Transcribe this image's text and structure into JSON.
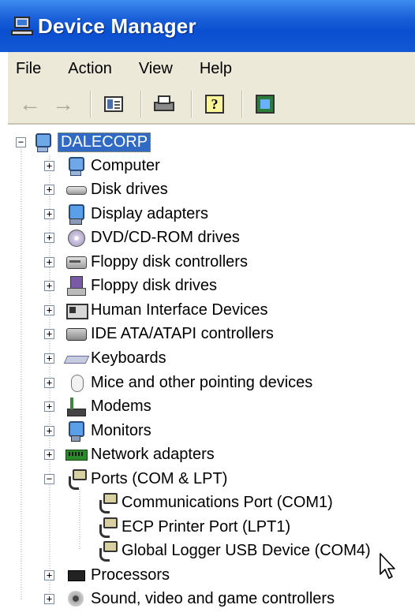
{
  "window": {
    "title": "Device Manager"
  },
  "menu": [
    "File",
    "Action",
    "View",
    "Help"
  ],
  "toolbar": {
    "buttons": [
      "back-icon",
      "forward-icon",
      "console-tree-icon",
      "print-icon",
      "help-icon",
      "scan-hardware-icon"
    ]
  },
  "tree": {
    "root": "DALECORP",
    "categories": [
      {
        "label": "Computer",
        "icon": "computer-icon",
        "expanded": false
      },
      {
        "label": "Disk drives",
        "icon": "disk-drive-icon",
        "expanded": false
      },
      {
        "label": "Display adapters",
        "icon": "display-adapter-icon",
        "expanded": false
      },
      {
        "label": "DVD/CD-ROM drives",
        "icon": "dvd-icon",
        "expanded": false
      },
      {
        "label": "Floppy disk controllers",
        "icon": "floppy-controller-icon",
        "expanded": false
      },
      {
        "label": "Floppy disk drives",
        "icon": "floppy-drive-icon",
        "expanded": false
      },
      {
        "label": "Human Interface Devices",
        "icon": "hid-icon",
        "expanded": false
      },
      {
        "label": "IDE ATA/ATAPI controllers",
        "icon": "ide-controller-icon",
        "expanded": false
      },
      {
        "label": "Keyboards",
        "icon": "keyboard-icon",
        "expanded": false
      },
      {
        "label": "Mice and other pointing devices",
        "icon": "mouse-icon",
        "expanded": false
      },
      {
        "label": "Modems",
        "icon": "modem-icon",
        "expanded": false
      },
      {
        "label": "Monitors",
        "icon": "monitor-icon",
        "expanded": false
      },
      {
        "label": "Network adapters",
        "icon": "network-adapter-icon",
        "expanded": false
      },
      {
        "label": "Ports (COM & LPT)",
        "icon": "port-icon",
        "expanded": true,
        "children": [
          "Communications Port (COM1)",
          "ECP Printer Port (LPT1)",
          "Global Logger USB Device (COM4)"
        ]
      },
      {
        "label": "Processors",
        "icon": "processor-icon",
        "expanded": false
      },
      {
        "label": "Sound, video and game controllers",
        "icon": "sound-icon",
        "expanded": false
      }
    ]
  },
  "colors": {
    "title_bar": "#0a4fd0",
    "selection": "#316ac5",
    "chrome": "#ece9d8"
  }
}
